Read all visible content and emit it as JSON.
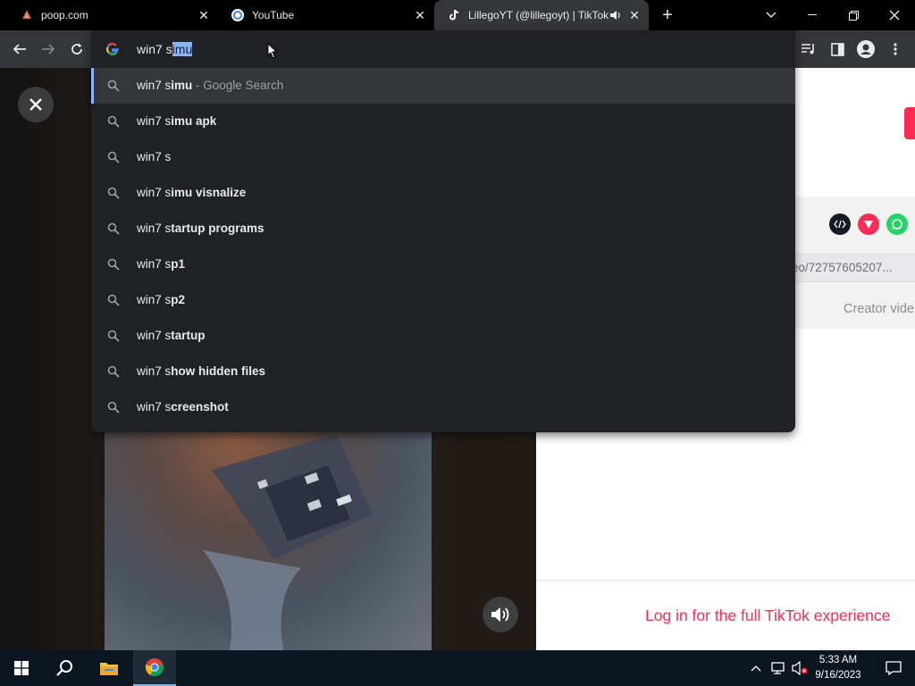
{
  "tabs": [
    {
      "title": "poop.com",
      "close": "✕"
    },
    {
      "title": "YouTube",
      "close": "✕"
    },
    {
      "title": "LillegoYT (@lillegoyt) | TikTok",
      "close": "✕"
    }
  ],
  "new_tab": "+",
  "window_controls": {
    "dropdown": "⌄",
    "minimize": "—",
    "restore": "❐",
    "close": "✕"
  },
  "omnibox": {
    "typed_prefix": "win7 s",
    "selected_completion": "imu",
    "suggestions": [
      {
        "prefix": "win7 s",
        "bold": "imu",
        "suffix": " - Google Search"
      },
      {
        "prefix": "win7 s",
        "bold": "imu apk",
        "suffix": ""
      },
      {
        "prefix": "win7 s",
        "bold": "",
        "suffix": ""
      },
      {
        "prefix": "win7 s",
        "bold": "imu visnalize",
        "suffix": ""
      },
      {
        "prefix": "win7 s",
        "bold": "tartup programs",
        "suffix": ""
      },
      {
        "prefix": "win7 s",
        "bold": "p1",
        "suffix": ""
      },
      {
        "prefix": "win7 s",
        "bold": "p2",
        "suffix": ""
      },
      {
        "prefix": "win7 s",
        "bold": "tartup",
        "suffix": ""
      },
      {
        "prefix": "win7 s",
        "bold": "how hidden files",
        "suffix": ""
      },
      {
        "prefix": "win7 s",
        "bold": "creenshot",
        "suffix": ""
      }
    ]
  },
  "page": {
    "video_url_fragment": "eo/72757605207...",
    "creator_tab": "Creator vide",
    "login_prompt": "Log in for the full TikTok experience"
  },
  "colors": {
    "accent": "#fe2c55",
    "omnibox_bg": "#202124",
    "selection": "#8ab4f8"
  },
  "taskbar": {
    "time": "5:33 AM",
    "date": "9/16/2023"
  }
}
